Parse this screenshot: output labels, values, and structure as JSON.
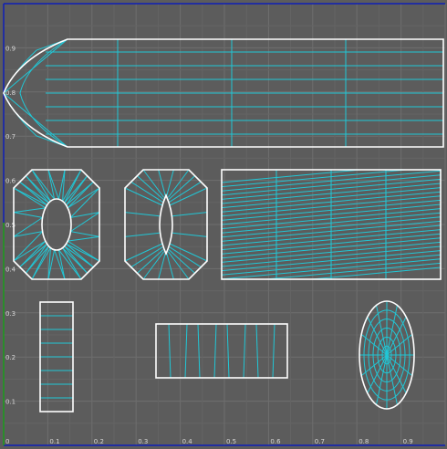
{
  "editor": {
    "view": "UV editor",
    "colors": {
      "background": "#5c5c5c",
      "grid_line": "#6e6e6e",
      "grid_fine": "#646464",
      "border_outline": "#ffffff",
      "inner_edge": "#21c7d6",
      "u_axis": "#0f1fb6",
      "v_axis": "#1a9b1a"
    }
  },
  "axes": {
    "u_ticks": [
      "0",
      "0.1",
      "0.2",
      "0.3",
      "0.4",
      "0.5",
      "0.6",
      "0.7",
      "0.8",
      "0.9"
    ],
    "v_ticks": [
      "0.1",
      "0.2",
      "0.3",
      "0.4",
      "0.5",
      "0.6",
      "0.7",
      "0.8",
      "0.9"
    ]
  },
  "uv_shells": [
    {
      "name": "long-bullet-shell",
      "shape": "bullet"
    },
    {
      "name": "octagon-oval-hole-shell",
      "shape": "octagon-with-oval-hole"
    },
    {
      "name": "octagon-lens-hole-shell",
      "shape": "octagon-with-lens-hole"
    },
    {
      "name": "slanted-strip-rectangle-shell",
      "shape": "rectangle-diagonal-strips"
    },
    {
      "name": "tall-strip-shell",
      "shape": "rectangle-horizontal-strips"
    },
    {
      "name": "wide-strip-shell",
      "shape": "rectangle-vertical-strips"
    },
    {
      "name": "ellipse-disk-shell",
      "shape": "radial-ellipse"
    }
  ]
}
